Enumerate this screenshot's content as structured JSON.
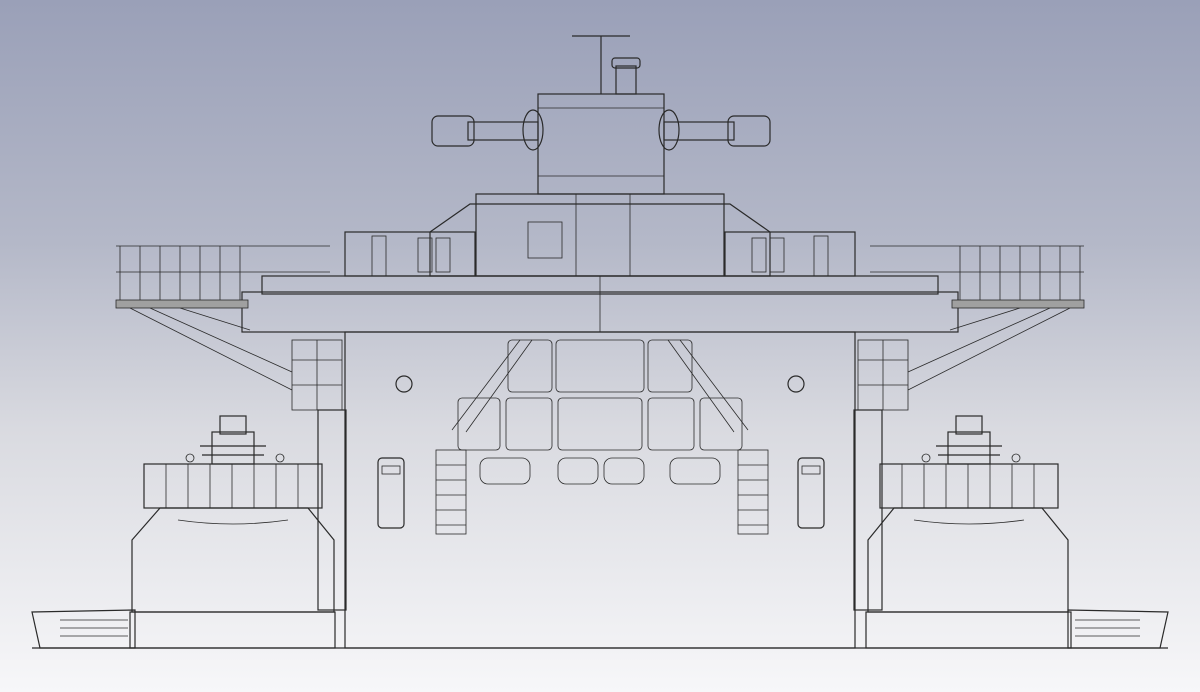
{
  "viewport": {
    "background": {
      "top": "#9aa0b8",
      "mid": "#d9dae0",
      "bottom": "#f7f7f9"
    },
    "render_mode": "shaded-with-edges"
  },
  "model": {
    "view": "front",
    "colors": {
      "hull_light": "#b5b5b5",
      "hull_mid": "#9c9c9c",
      "hull_dark": "#6e6e6e",
      "edge": "#2a2a2a"
    }
  }
}
